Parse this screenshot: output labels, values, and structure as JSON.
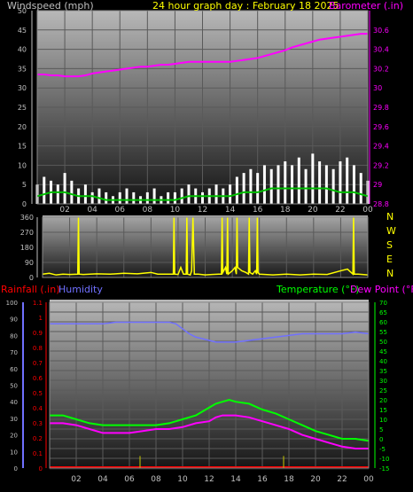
{
  "colors": {
    "windspeed_label": "#c0c0c0",
    "title": "#ffff00",
    "barometer": "#ff00ff",
    "rainfall": "#ff0000",
    "humidity": "#7070ff",
    "temperature": "#00ff00",
    "dew_point": "#ff00ff",
    "direction": "#ffff00",
    "axis_left": "#c0c0c0",
    "axis_rain": "#ff0000",
    "axis_temp": "#00ff00",
    "axis_baro": "#ff00ff",
    "axis_hum": "#7070ff",
    "wind": "#ffffff",
    "wind_avg": "#00c000"
  },
  "chart_data": [
    {
      "type": "line",
      "title": "24 hour graph day : February 18 2025",
      "legend": {
        "wind": "Windspeed (mph)",
        "baro": "Barometer (.in)"
      },
      "x_ticks": [
        "02",
        "04",
        "06",
        "08",
        "10",
        "12",
        "14",
        "16",
        "18",
        "20",
        "22",
        "00"
      ],
      "wind_axis": {
        "ylim": [
          0,
          50
        ],
        "ticks": [
          "0",
          "5",
          "10",
          "15",
          "20",
          "25",
          "30",
          "35",
          "40",
          "45",
          "50"
        ]
      },
      "baro_axis": {
        "ylim": [
          28.8,
          30.8
        ],
        "ticks": [
          "28.8",
          "29",
          "29.2",
          "29.4",
          "29.6",
          "29.8",
          "30",
          "30.2",
          "30.4",
          "30.6"
        ]
      },
      "series": [
        {
          "name": "Barometer (.in)",
          "x": [
            0,
            0.5,
            1,
            1.5,
            2,
            2.5,
            3,
            3.5,
            4,
            4.5,
            5,
            5.5,
            6,
            6.5,
            7,
            7.5,
            8,
            8.5,
            9,
            9.5,
            10,
            10.5,
            11,
            11.5,
            12,
            12.5,
            13,
            13.5,
            14,
            14.5,
            15,
            15.5,
            16,
            16.5,
            17,
            17.5,
            18,
            18.5,
            19,
            19.5,
            20,
            20.5,
            21,
            21.5,
            22,
            22.5,
            23,
            23.5,
            24
          ],
          "values": [
            30.14,
            30.14,
            30.13,
            30.13,
            30.12,
            30.12,
            30.12,
            30.13,
            30.15,
            30.16,
            30.17,
            30.18,
            30.19,
            30.2,
            30.21,
            30.22,
            30.22,
            30.23,
            30.24,
            30.24,
            30.25,
            30.26,
            30.27,
            30.27,
            30.27,
            30.27,
            30.27,
            30.27,
            30.27,
            30.28,
            30.29,
            30.3,
            30.31,
            30.33,
            30.35,
            30.37,
            30.39,
            30.42,
            30.44,
            30.46,
            30.48,
            30.5,
            30.51,
            30.52,
            30.53,
            30.54,
            30.55,
            30.56,
            30.56
          ]
        },
        {
          "name": "Windspeed (mph)",
          "x": [
            0,
            0.5,
            1,
            1.5,
            2,
            2.5,
            3,
            3.5,
            4,
            4.5,
            5,
            5.5,
            6,
            6.5,
            7,
            7.5,
            8,
            8.5,
            9,
            9.5,
            10,
            10.5,
            11,
            11.5,
            12,
            12.5,
            13,
            13.5,
            14,
            14.5,
            15,
            15.5,
            16,
            16.5,
            17,
            17.5,
            18,
            18.5,
            19,
            19.5,
            20,
            20.5,
            21,
            21.5,
            22,
            22.5,
            23,
            23.5,
            24
          ],
          "values": [
            5,
            7,
            6,
            5,
            8,
            6,
            4,
            5,
            3,
            4,
            3,
            2,
            3,
            4,
            3,
            2,
            3,
            4,
            2,
            3,
            3,
            4,
            5,
            4,
            3,
            4,
            5,
            4,
            5,
            7,
            8,
            9,
            8,
            10,
            9,
            10,
            11,
            10,
            12,
            9,
            13,
            11,
            10,
            9,
            11,
            12,
            10,
            8,
            6
          ]
        },
        {
          "name": "Wind average",
          "x": [
            0,
            1,
            2,
            3,
            4,
            5,
            6,
            7,
            8,
            9,
            10,
            11,
            12,
            13,
            14,
            15,
            16,
            17,
            18,
            19,
            20,
            21,
            22,
            23,
            24
          ],
          "values": [
            2,
            3,
            3,
            2,
            2,
            1,
            1,
            1,
            1,
            1,
            1,
            2,
            2,
            2,
            2,
            3,
            3,
            4,
            4,
            4,
            4,
            4,
            3,
            3,
            2
          ]
        }
      ]
    },
    {
      "type": "line",
      "legend": [
        "N",
        "W",
        "S",
        "E",
        "N"
      ],
      "y_ticks": [
        "0",
        "90",
        "180",
        "270",
        "360"
      ],
      "ylim": [
        0,
        360
      ],
      "x_ticks": [
        "02",
        "04",
        "06",
        "08",
        "10",
        "12",
        "14",
        "16",
        "18",
        "20",
        "22",
        "00"
      ],
      "series": [
        {
          "name": "Wind direction",
          "x": [
            0,
            0.5,
            1,
            1.5,
            2,
            2.6,
            2.65,
            2.7,
            3,
            4,
            5,
            6,
            7,
            8,
            8.5,
            9,
            9.5,
            9.65,
            9.7,
            9.75,
            10,
            10.2,
            10.4,
            10.6,
            10.65,
            10.7,
            10.9,
            11,
            11.1,
            11.2,
            11.5,
            12,
            12.5,
            13,
            13.2,
            13.25,
            13.3,
            13.5,
            13.6,
            13.65,
            13.7,
            14,
            14.2,
            14.3,
            14.35,
            14.4,
            14.7,
            15,
            15.2,
            15.25,
            15.3,
            15.5,
            15.7,
            15.8,
            15.85,
            15.9,
            16,
            17,
            18,
            19,
            20,
            21,
            22,
            22.5,
            22.9,
            22.95,
            23,
            23.3,
            24
          ],
          "values": [
            20,
            25,
            15,
            20,
            18,
            20,
            360,
            20,
            18,
            22,
            20,
            25,
            22,
            30,
            20,
            20,
            20,
            20,
            360,
            20,
            18,
            60,
            20,
            20,
            360,
            20,
            15,
            40,
            360,
            20,
            20,
            15,
            18,
            20,
            20,
            360,
            30,
            60,
            20,
            360,
            20,
            40,
            60,
            20,
            360,
            60,
            40,
            30,
            20,
            360,
            30,
            20,
            40,
            20,
            360,
            30,
            20,
            15,
            20,
            15,
            20,
            18,
            40,
            50,
            20,
            360,
            20,
            20,
            15
          ]
        }
      ]
    },
    {
      "type": "line",
      "legend": {
        "rain": "Rainfall (.in)",
        "humidity": "Humidity",
        "temp": "Temperature (°F)",
        "dew": "Dew Point (°F)"
      },
      "x_ticks": [
        "02",
        "04",
        "06",
        "08",
        "10",
        "12",
        "14",
        "16",
        "18",
        "20",
        "22",
        "00"
      ],
      "humidity_axis": {
        "ylim": [
          0,
          100
        ],
        "ticks": [
          "0",
          "10",
          "20",
          "30",
          "40",
          "50",
          "60",
          "70",
          "80",
          "90",
          "100"
        ]
      },
      "rain_axis": {
        "ylim": [
          0,
          1.1
        ],
        "ticks": [
          "0",
          "0.1",
          "0.2",
          "0.3",
          "0.4",
          "0.5",
          "0.6",
          "0.7",
          "0.8",
          "0.9",
          "1",
          "1.1"
        ]
      },
      "temp_axis": {
        "ylim": [
          -15,
          70
        ],
        "ticks": [
          "-15",
          "-10",
          "-5",
          "0",
          "5",
          "10",
          "15",
          "20",
          "25",
          "30",
          "35",
          "40",
          "45",
          "50",
          "55",
          "60",
          "65",
          "70"
        ]
      },
      "series": [
        {
          "name": "Humidity",
          "x": [
            0,
            1,
            2,
            3,
            4,
            5,
            6,
            7,
            8,
            9,
            9.5,
            10,
            10.5,
            11,
            11.5,
            12,
            12.5,
            13,
            14,
            15,
            16,
            17,
            18,
            19,
            20,
            21,
            22,
            23,
            24
          ],
          "values": [
            87,
            87,
            87,
            87,
            87,
            88,
            88,
            88,
            88,
            88,
            87,
            84,
            81,
            79,
            78,
            77,
            76,
            76,
            76,
            77,
            78,
            79,
            80,
            81,
            81,
            81,
            81,
            82,
            81
          ]
        },
        {
          "name": "Temperature (°F)",
          "x": [
            0,
            1,
            2,
            3,
            4,
            5,
            6,
            7,
            8,
            9,
            10,
            11,
            12,
            12.5,
            13,
            13.5,
            14,
            15,
            16,
            17,
            18,
            19,
            20,
            21,
            22,
            23,
            24
          ],
          "values": [
            12,
            12,
            10,
            8,
            7,
            7,
            7,
            7,
            7,
            8,
            10,
            12,
            16,
            18,
            19,
            20,
            19,
            18,
            15,
            13,
            10,
            7,
            4,
            2,
            0,
            0,
            -1
          ]
        },
        {
          "name": "Dew Point (°F)",
          "x": [
            0,
            1,
            2,
            3,
            4,
            5,
            6,
            7,
            8,
            9,
            10,
            11,
            12,
            12.5,
            13,
            13.5,
            14,
            15,
            16,
            17,
            18,
            19,
            20,
            21,
            22,
            23,
            24
          ],
          "values": [
            8,
            8,
            7,
            5,
            3,
            3,
            3,
            4,
            5,
            5,
            6,
            8,
            9,
            11,
            12,
            12,
            12,
            11,
            9,
            7,
            5,
            2,
            0,
            -2,
            -4,
            -5,
            -5
          ]
        },
        {
          "name": "Rainfall (.in)",
          "x": [
            0,
            24
          ],
          "values": [
            0,
            0
          ]
        },
        {
          "name": "Rain rate marks",
          "x": [
            6.8,
            17.6
          ],
          "values": [
            0.08,
            0.08
          ]
        }
      ]
    }
  ]
}
